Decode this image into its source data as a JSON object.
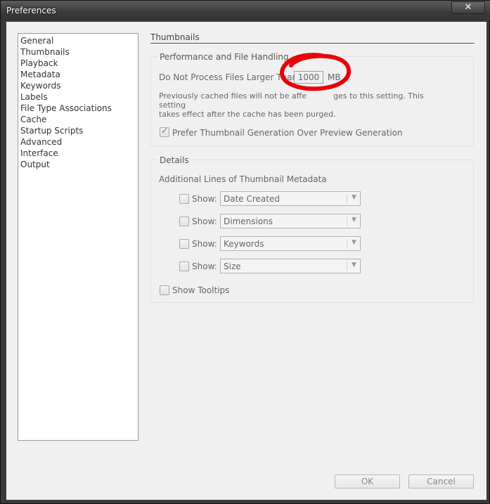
{
  "window": {
    "title": "Preferences",
    "close_glyph": "✕"
  },
  "sidebar": {
    "items": [
      {
        "label": "General"
      },
      {
        "label": "Thumbnails"
      },
      {
        "label": "Playback"
      },
      {
        "label": "Metadata"
      },
      {
        "label": "Keywords"
      },
      {
        "label": "Labels"
      },
      {
        "label": "File Type Associations"
      },
      {
        "label": "Cache"
      },
      {
        "label": "Startup Scripts"
      },
      {
        "label": "Advanced"
      },
      {
        "label": "Interface"
      },
      {
        "label": "Output"
      }
    ]
  },
  "main": {
    "section_title": "Thumbnails",
    "performance": {
      "legend": "Performance and File Handling",
      "max_size_label": "Do Not Process Files Larger Than:",
      "max_size_value": "1000",
      "max_size_unit": "MB",
      "note_line1": "Previously cached files will not be affe",
      "note_line1b": "ges to this setting. This setting",
      "note_line2": "takes effect after the cache has been purged.",
      "prefer_label": "Prefer Thumbnail Generation Over Preview Generation",
      "prefer_checked": true
    },
    "details": {
      "legend": "Details",
      "subheading": "Additional Lines of Thumbnail Metadata",
      "rows": [
        {
          "show_label": "Show:",
          "checked": false,
          "value": "Date Created"
        },
        {
          "show_label": "Show:",
          "checked": false,
          "value": "Dimensions"
        },
        {
          "show_label": "Show:",
          "checked": false,
          "value": "Keywords"
        },
        {
          "show_label": "Show:",
          "checked": false,
          "value": "Size"
        }
      ],
      "tooltips_label": "Show Tooltips",
      "tooltips_checked": false
    }
  },
  "buttons": {
    "ok": "OK",
    "cancel": "Cancel"
  },
  "colors": {
    "annotation": "#e8000b",
    "panel_bg": "#f0f0f0",
    "frame": "#3a3a3a"
  }
}
